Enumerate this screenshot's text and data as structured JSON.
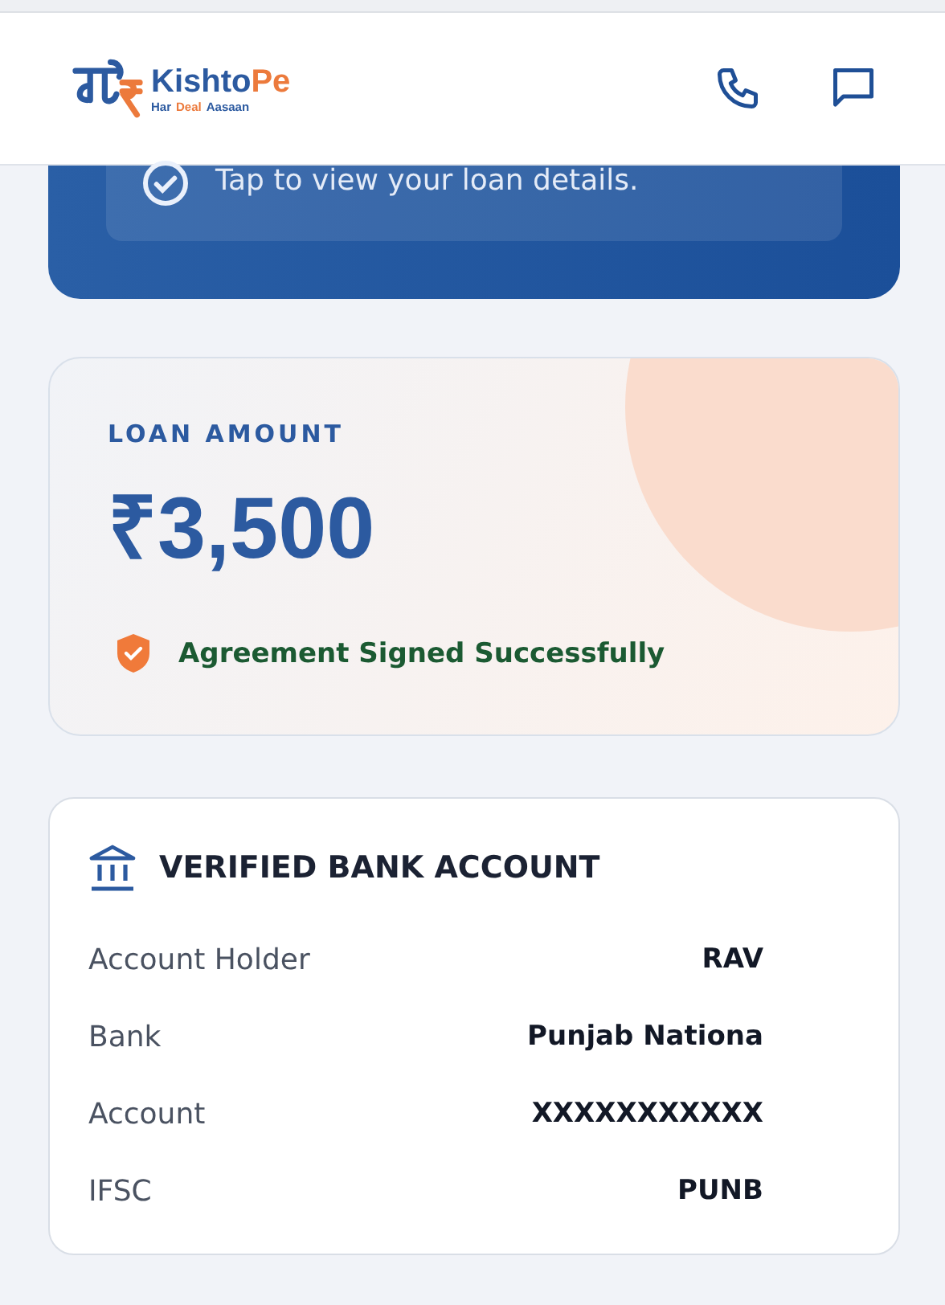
{
  "header": {
    "brand": {
      "name_main": "Kishto",
      "name_accent": "Pe",
      "tagline": [
        "Har",
        "Deal",
        "Aasaan"
      ]
    }
  },
  "loan_banner": {
    "hint": "Tap to view your loan details."
  },
  "loan_card": {
    "label": "LOAN AMOUNT",
    "amount": "₹3,500",
    "status": "Agreement Signed Successfully"
  },
  "bank_card": {
    "title": "VERIFIED BANK ACCOUNT",
    "rows": [
      {
        "label": "Account Holder",
        "value": "RAV"
      },
      {
        "label": "Bank",
        "value": "Punjab Nationa"
      },
      {
        "label": "Account",
        "value": "XXXXXXXXXXX"
      },
      {
        "label": "IFSC",
        "value": "PUNB"
      }
    ]
  }
}
